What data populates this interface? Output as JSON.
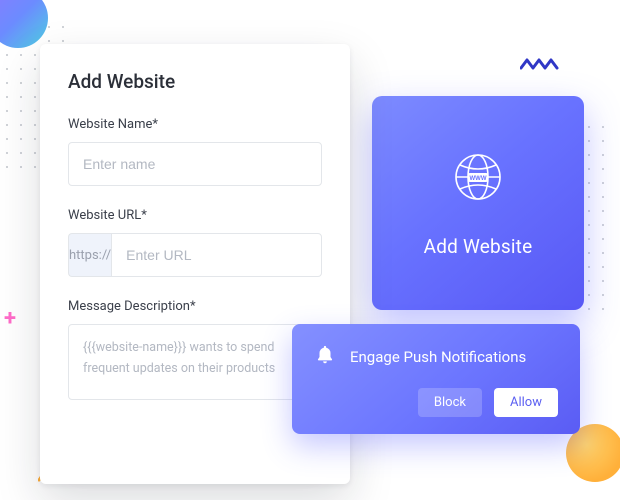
{
  "form": {
    "title": "Add Website",
    "website_name": {
      "label": "Website Name*",
      "placeholder": "Enter name"
    },
    "website_url": {
      "label": "Website URL*",
      "prefix": "https://",
      "placeholder": "Enter URL"
    },
    "message_description": {
      "label": "Message Description*",
      "placeholder": "{{{website-name}}} wants to spend frequent updates on their products"
    }
  },
  "brand_card": {
    "title": "Add Website"
  },
  "notification": {
    "title": "Engage Push Notifications",
    "block_label": "Block",
    "allow_label": "Allow"
  },
  "colors": {
    "brand_gradient_start": "#7d8bff",
    "brand_gradient_end": "#5858f5",
    "accent_orange": "#ffb03a",
    "accent_purple": "#8a7cff"
  }
}
